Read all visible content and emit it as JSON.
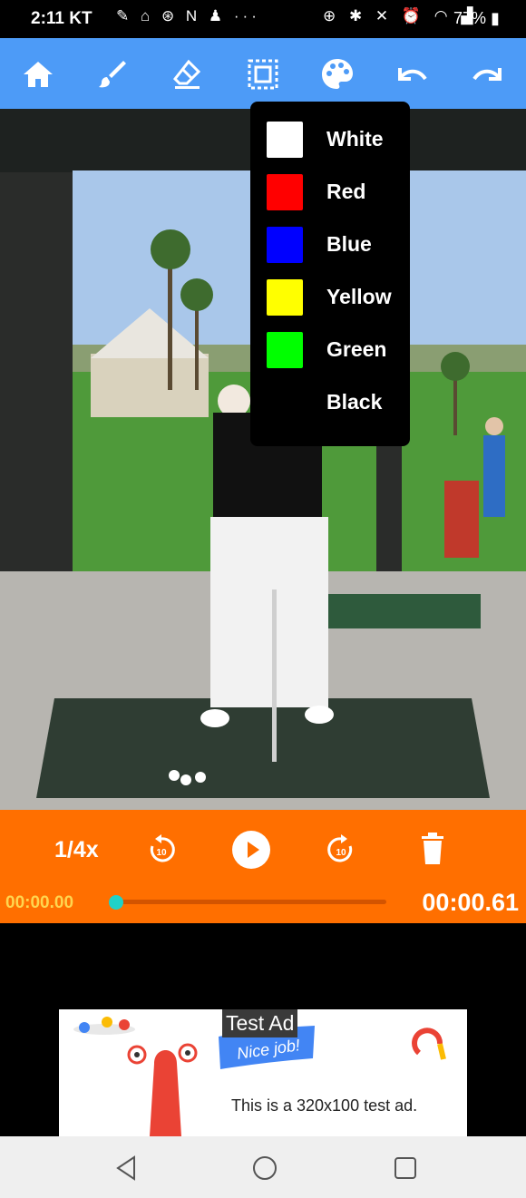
{
  "status_bar": {
    "time": "2:11",
    "carrier": "KT",
    "battery_percent": "77%",
    "left_icons": [
      "pen-icon",
      "home-person-icon",
      "accessibility-icon",
      "n-icon",
      "person-icon",
      "more-icon"
    ],
    "right_icons": [
      "add-circle-icon",
      "bluetooth-icon",
      "mute-icon",
      "alarm-icon",
      "wifi-icon",
      "signal-icon"
    ]
  },
  "toolbar": {
    "buttons": [
      "home-icon",
      "brush-icon",
      "eraser-icon",
      "select-area-icon",
      "palette-icon",
      "undo-icon",
      "redo-icon"
    ],
    "color": "#4d9bf7"
  },
  "color_menu": {
    "items": [
      {
        "label": "White",
        "color": "#ffffff"
      },
      {
        "label": "Red",
        "color": "#ff0000"
      },
      {
        "label": "Blue",
        "color": "#0000ff"
      },
      {
        "label": "Yellow",
        "color": "#ffff00"
      },
      {
        "label": "Green",
        "color": "#00ff00"
      },
      {
        "label": "Black",
        "color": "#000000"
      }
    ]
  },
  "player": {
    "speed": "1/4x",
    "current_time": "00:00.00",
    "total_time": "00:00.61",
    "progress": 0.0,
    "accent": "#ff6f00"
  },
  "ad": {
    "badge": "Test Ad",
    "banner_text": "Nice job!",
    "text": "This is a 320x100 test ad."
  },
  "nav": {
    "buttons": [
      "back-icon",
      "home-circle-icon",
      "recents-icon"
    ]
  }
}
